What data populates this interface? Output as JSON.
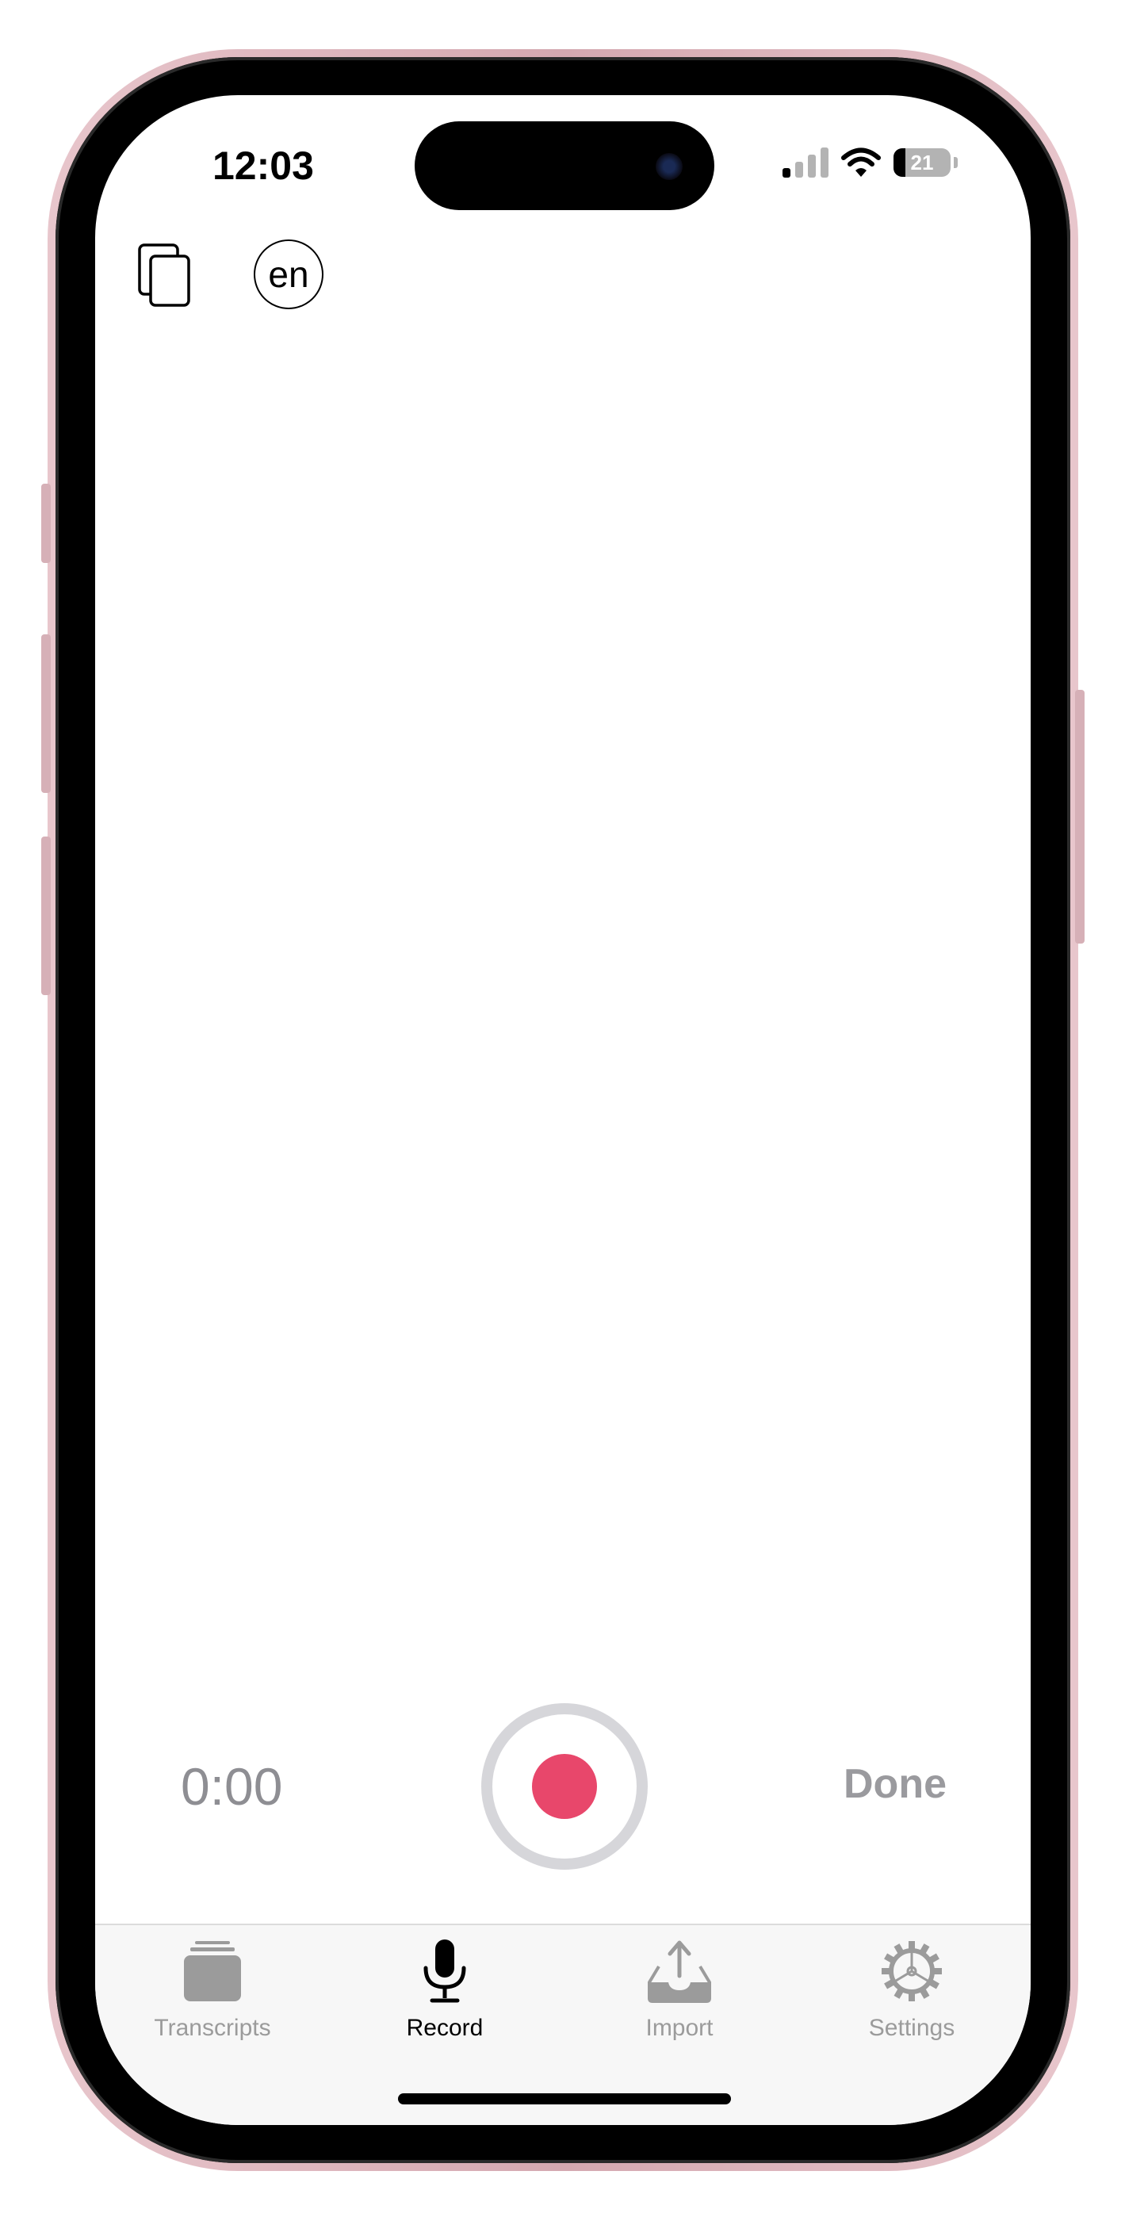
{
  "status_bar": {
    "time": "12:03",
    "battery_level": "21",
    "battery_fraction": 0.21
  },
  "top_bar": {
    "copy_icon": "copy-icon",
    "language": "en"
  },
  "recorder": {
    "elapsed_time": "0:00",
    "record_icon": "record-icon",
    "done_label": "Done",
    "colors": {
      "record": "#e8476b",
      "ring": "#d6d6da",
      "muted": "#8e8e93"
    }
  },
  "tab_bar": {
    "tabs": [
      {
        "label": "Transcripts",
        "icon": "stack-icon",
        "active": false
      },
      {
        "label": "Record",
        "icon": "microphone-icon",
        "active": true
      },
      {
        "label": "Import",
        "icon": "tray-upload-icon",
        "active": false
      },
      {
        "label": "Settings",
        "icon": "gear-icon",
        "active": false
      }
    ],
    "colors": {
      "active": "#000000",
      "inactive": "#9b9b9b"
    }
  }
}
